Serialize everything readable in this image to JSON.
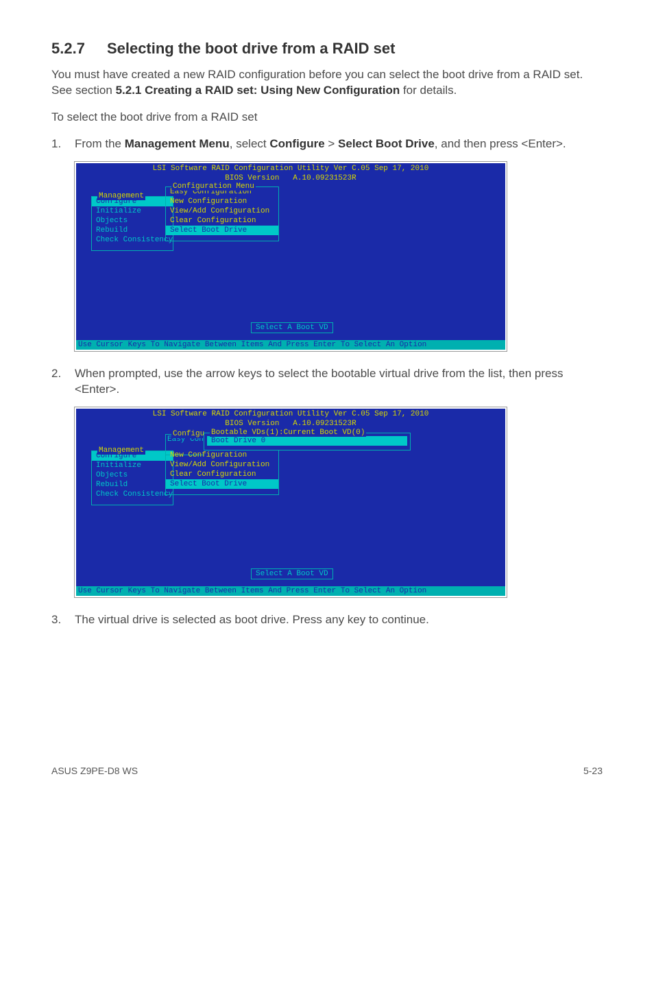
{
  "section": {
    "number": "5.2.7",
    "title": "Selecting the boot drive from a RAID set"
  },
  "intro1": "You must have created a new RAID configuration before you can select the boot drive from a RAID set. See section ",
  "intro1_b": "5.2.1 Creating a RAID set: Using New Configuration",
  "intro1_tail": " for details.",
  "intro2": "To select the boot drive from a RAID set",
  "steps": [
    {
      "n": "1.",
      "pre": "From the ",
      "b1": "Management Menu",
      "mid1": ", select ",
      "b2": "Configure",
      "mid2": " > ",
      "b3": "Select Boot Drive",
      "tail": ", and then press <Enter>."
    },
    {
      "n": "2.",
      "plain": "When prompted, use the arrow keys to select the bootable virtual drive from the list, then press <Enter>."
    },
    {
      "n": "3.",
      "plain": "The virtual drive is selected as boot drive. Press any key to continue."
    }
  ],
  "bios": {
    "title_line": "LSI Software RAID Configuration Utility Ver C.05 Sep 17, 2010",
    "bios_line": "BIOS Version   A.10.09231523R",
    "management_label": "Management",
    "mgmt_items": [
      "Configure",
      "Initialize",
      "Objects",
      "Rebuild",
      "Check Consistency"
    ],
    "cfg_label": "Configuration Menu",
    "cfg_items": [
      "Easy Configuration",
      "New Configuration",
      "View/Add Configuration",
      "Clear Configuration",
      "Select Boot Drive"
    ],
    "hint": "Select A Boot VD",
    "footer": "Use Cursor Keys To Navigate Between Items And Press Enter To Select An Option",
    "bootable_label": "Bootable VDs(1):Current Boot VD(0)",
    "boot_item": "Boot Drive 0",
    "cfg_short": "Configu",
    "easy_short": "Easy Con"
  },
  "footer": {
    "left": "ASUS Z9PE-D8 WS",
    "right": "5-23"
  }
}
